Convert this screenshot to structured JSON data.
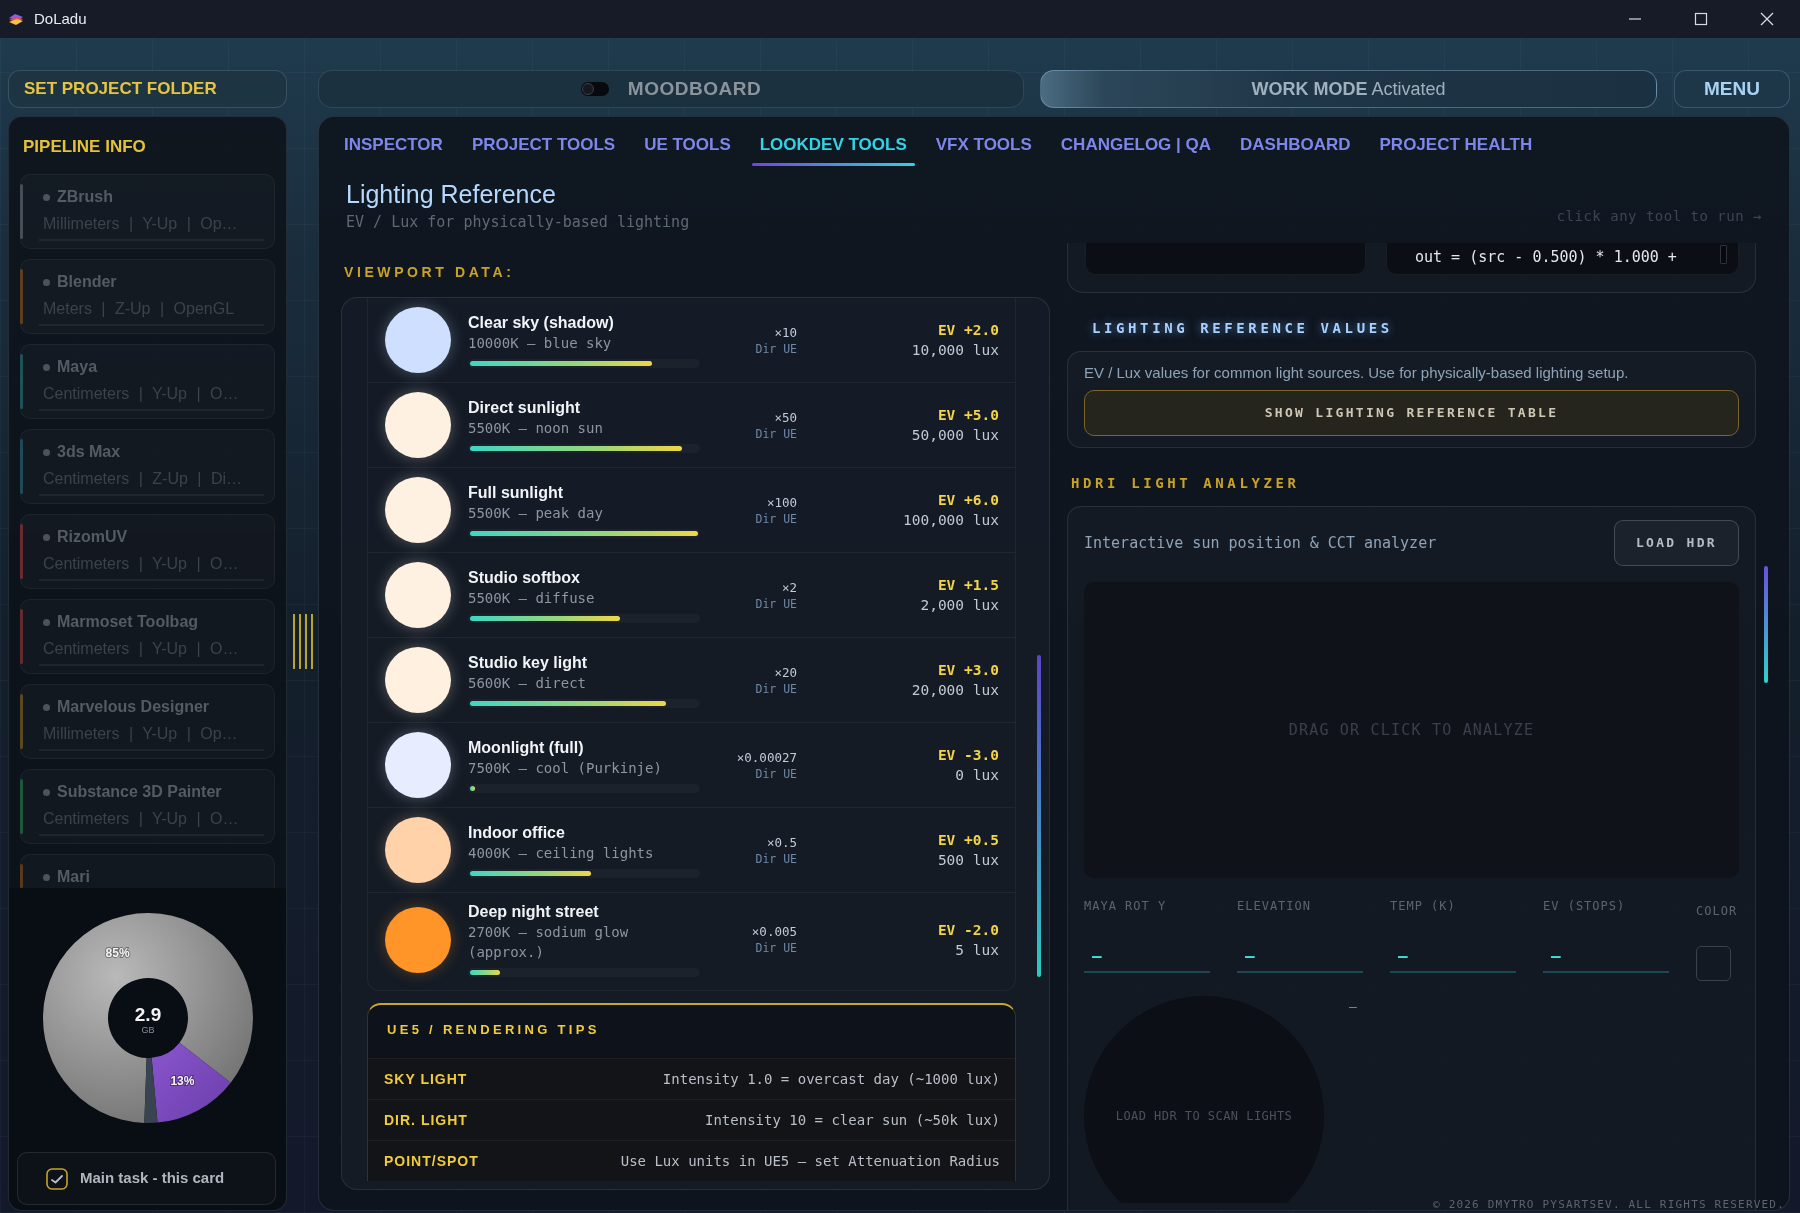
{
  "window": {
    "title": "DoLadu"
  },
  "toolbar": {
    "folder_button": "SET PROJECT FOLDER",
    "moodboard": {
      "label": "MOODBOARD",
      "on": false
    },
    "work_mode": "**WORK MODE** Activated",
    "menu_button": "MENU"
  },
  "sidebar": {
    "title": "PIPELINE INFO",
    "apps": [
      {
        "name": "ZBrush",
        "details": "Millimeters | Y-Up | Op…",
        "color": "#474c55"
      },
      {
        "name": "Blender",
        "details": "Meters | Z-Up | OpenGL",
        "color": "#5e401f"
      },
      {
        "name": "Maya",
        "details": "Centimeters | Y-Up | O…",
        "color": "#1d5356"
      },
      {
        "name": "3ds Max",
        "details": "Centimeters | Z-Up | Di…",
        "color": "#1f4b58"
      },
      {
        "name": "RizomUV",
        "details": "Centimeters | Y-Up | O…",
        "color": "#6b2a2f"
      },
      {
        "name": "Marmoset Toolbag",
        "details": "Centimeters | Y-Up | O…",
        "color": "#66292e"
      },
      {
        "name": "Marvelous Designer",
        "details": "Millimeters | Y-Up | Op…",
        "color": "#5c481d"
      },
      {
        "name": "Substance 3D Painter",
        "details": "Centimeters | Y-Up | O…",
        "color": "#1e573a"
      },
      {
        "name": "Mari",
        "color": "#5c391d"
      }
    ],
    "storage": {
      "center_value": "2.9",
      "center_unit": "GB",
      "chart_data": {
        "type": "donut",
        "values": [
          85,
          13,
          2
        ],
        "value_labels": [
          "85%",
          "13%",
          null
        ]
      }
    },
    "task": {
      "label": "Main task - this card",
      "checked": true
    }
  },
  "tabs": [
    {
      "label": "INSPECTOR",
      "selected": false
    },
    {
      "label": "PROJECT TOOLS",
      "selected": false
    },
    {
      "label": "UE TOOLS",
      "selected": false
    },
    {
      "label": "LOOKDEV TOOLS",
      "selected": true
    },
    {
      "label": "VFX TOOLS",
      "selected": false
    },
    {
      "label": "CHANGELOG | QA",
      "selected": false
    },
    {
      "label": "DASHBOARD",
      "selected": false
    },
    {
      "label": "PROJECT HEALTH",
      "selected": false
    }
  ],
  "page": {
    "title": "Lighting Reference",
    "subtitle": "EV / Lux for physically-based lighting",
    "hint": "click any tool to run →"
  },
  "viewport": {
    "title": "VIEWPORT DATA:",
    "lights": [
      {
        "name": "Clear sky (shadow)",
        "detail": "10000K — blue sky",
        "level": 0.8,
        "color": "#cfdfff",
        "multiplier": "×10",
        "target": "Dir UE",
        "ev": "EV +2.0",
        "lux": "10,000 lux"
      },
      {
        "name": "Direct sunlight",
        "detail": "5500K — noon sun",
        "level": 0.93,
        "color": "#fff1e2",
        "multiplier": "×50",
        "target": "Dir UE",
        "ev": "EV +5.0",
        "lux": "50,000 lux"
      },
      {
        "name": "Full sunlight",
        "detail": "5500K — peak day",
        "level": 1,
        "color": "#fff1e2",
        "multiplier": "×100",
        "target": "Dir UE",
        "ev": "EV +6.0",
        "lux": "100,000 lux"
      },
      {
        "name": "Studio softbox",
        "detail": "5500K — diffuse",
        "level": 0.66,
        "color": "#fff1e2",
        "multiplier": "×2",
        "target": "Dir UE",
        "ev": "EV +1.5",
        "lux": "2,000 lux"
      },
      {
        "name": "Studio key light",
        "detail": "5600K — direct",
        "level": 0.86,
        "color": "#fff0df",
        "multiplier": "×20",
        "target": "Dir UE",
        "ev": "EV +3.0",
        "lux": "20,000 lux"
      },
      {
        "name": "Moonlight (full)",
        "detail": "7500K — cool (Purkinje)",
        "level": 0.02,
        "color": "#e7ecff",
        "multiplier": "×0.00027",
        "target": "Dir UE",
        "ev": "EV -3.0",
        "lux": "0 lux"
      },
      {
        "name": "Indoor office",
        "detail": "4000K — ceiling lights",
        "level": 0.53,
        "color": "#ffd2a9",
        "multiplier": "×0.5",
        "target": "Dir UE",
        "ev": "EV +0.5",
        "lux": "500 lux"
      },
      {
        "name": "Deep night street",
        "detail": "2700K — sodium glow (approx.)",
        "level": 0.13,
        "color": "#ff9428",
        "multiplier": "×0.005",
        "target": "Dir UE",
        "ev": "EV -2.0",
        "lux": "5 lux"
      }
    ]
  },
  "tips": {
    "title": "UE5 / RENDERING TIPS",
    "rows": [
      {
        "key": "SKY LIGHT",
        "value": "Intensity 1.0 = overcast day (~1000 lux)"
      },
      {
        "key": "DIR. LIGHT",
        "value": "Intensity 10 = clear sun (~50k lux)"
      },
      {
        "key": "POINT/SPOT",
        "value": "Use Lux units in UE5 — set Attenuation Radius"
      }
    ]
  },
  "formula": {
    "code": "out = (src - 0.500) * 1.000 +"
  },
  "reference": {
    "title": "LIGHTING REFERENCE VALUES",
    "description": "EV / Lux values for common light sources. Use for physically-based lighting setup.",
    "button": "SHOW LIGHTING REFERENCE TABLE"
  },
  "analyzer": {
    "title": "HDRI LIGHT ANALYZER",
    "description": "Interactive sun position & CCT analyzer",
    "load_button": "LOAD HDR",
    "drop_hint": "DRAG OR CLICK TO ANALYZE",
    "fields": [
      {
        "label": "MAYA ROT Y",
        "value": "–"
      },
      {
        "label": "ELEVATION",
        "value": "–"
      },
      {
        "label": "TEMP (K)",
        "value": "–"
      },
      {
        "label": "EV (STOPS)",
        "value": "–"
      }
    ],
    "color_label": "COLOR",
    "readout": "–",
    "scan_hint": "LOAD HDR TO SCAN LIGHTS"
  },
  "footer": "© 2026 DMYTRO PYSARTSEV. ALL RIGHTS RESERVED."
}
